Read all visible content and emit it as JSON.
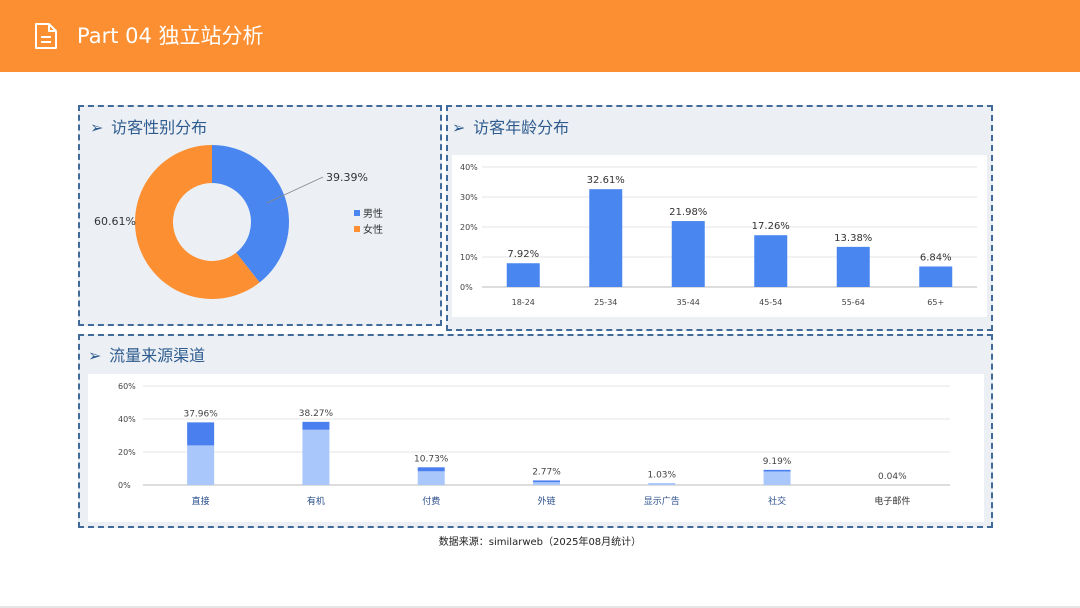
{
  "header": {
    "title": "Part 04 独立站分析",
    "icon": "document-icon",
    "color": "#fb8f31"
  },
  "panels": {
    "gender": {
      "title": "访客性别分布",
      "arrow": "➢"
    },
    "age": {
      "title": "访客年龄分布",
      "arrow": "➢"
    },
    "traffic": {
      "title": "流量来源渠道",
      "arrow": "➢"
    }
  },
  "chart_data": [
    {
      "id": "gender",
      "type": "pie",
      "donut": true,
      "labels": [
        "男性",
        "女性"
      ],
      "values": [
        39.39,
        60.61
      ],
      "value_labels": [
        "39.39%",
        "60.61%"
      ],
      "colors": [
        "#4a86f0",
        "#fb8f31"
      ],
      "legend": "right"
    },
    {
      "id": "age",
      "type": "bar",
      "categories": [
        "18-24",
        "25-34",
        "35-44",
        "45-54",
        "55-64",
        "65+"
      ],
      "values": [
        7.92,
        32.61,
        21.98,
        17.26,
        13.38,
        6.84
      ],
      "value_labels": [
        "7.92%",
        "32.61%",
        "21.98%",
        "17.26%",
        "13.38%",
        "6.84%"
      ],
      "yticks": [
        "0%",
        "10%",
        "20%",
        "30%",
        "40%"
      ],
      "ylim": [
        0,
        40
      ],
      "grid": true,
      "color": "#4a86f0"
    },
    {
      "id": "traffic",
      "type": "bar",
      "stacked": true,
      "categories": [
        "直接",
        "有机",
        "付费",
        "外链",
        "显示广告",
        "社交",
        "电子邮件"
      ],
      "totals": [
        37.96,
        38.27,
        10.73,
        2.77,
        1.03,
        9.19,
        0.04
      ],
      "lower_values": [
        24,
        33.5,
        8.3,
        1.7,
        0.9,
        8.2,
        0.04
      ],
      "value_labels": [
        "37.96%",
        "38.27%",
        "10.73%",
        "2.77%",
        "1.03%",
        "9.19%",
        "0.04%"
      ],
      "yticks": [
        "0%",
        "20%",
        "40%",
        "60%"
      ],
      "ylim": [
        0,
        60
      ],
      "grid": true,
      "colors": [
        "#a9c7fb",
        "#4a7ff0"
      ],
      "category_colors": [
        "#2b4f8c",
        "#2b4f8c",
        "#2b4f8c",
        "#2b4f8c",
        "#2b4f8c",
        "#2b4f8c",
        "#333333"
      ]
    }
  ],
  "footer": {
    "source": "数据来源：similarweb（2025年08月统计）"
  }
}
